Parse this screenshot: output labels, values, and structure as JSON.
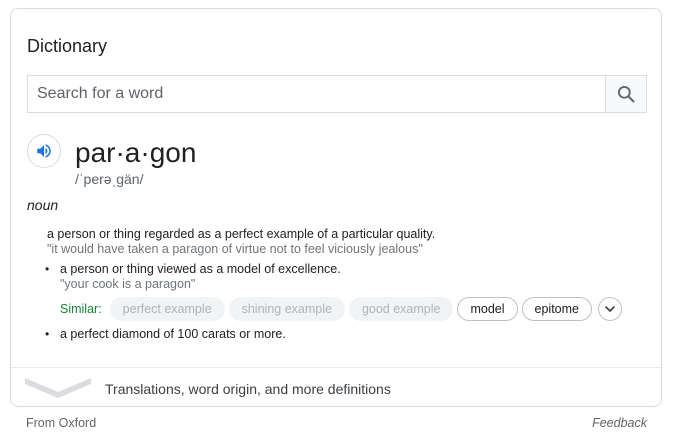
{
  "widget": {
    "title": "Dictionary"
  },
  "search": {
    "placeholder": "Search for a word",
    "value": "",
    "button_icon": "search-icon"
  },
  "entry": {
    "audio_icon": "speaker-icon",
    "word": "par·a·gon",
    "phonetic": "/ˈperəˌɡän/",
    "part_of_speech": "noun",
    "definitions": [
      {
        "text": "a person or thing regarded as a perfect example of a particular quality.",
        "example": "\"it would have taken a paragon of virtue not to feel viciously jealous\""
      },
      {
        "bullet": "•",
        "text": "a person or thing viewed as a model of excellence.",
        "example": "\"your cook is a paragon\"",
        "similar_label": "Similar:",
        "similar": [
          "perfect example",
          "shining example",
          "good example",
          "model",
          "epitome"
        ]
      },
      {
        "bullet": "•",
        "text": "a perfect diamond of 100 carats or more."
      }
    ]
  },
  "expand": {
    "label": "Translations, word origin, and more definitions"
  },
  "footer": {
    "source": "From Oxford",
    "feedback": "Feedback"
  },
  "colors": {
    "border": "#dadce0",
    "text": "#202124",
    "muted": "#70757a",
    "similar_green": "#188038",
    "audio_blue": "#1a73e8"
  }
}
